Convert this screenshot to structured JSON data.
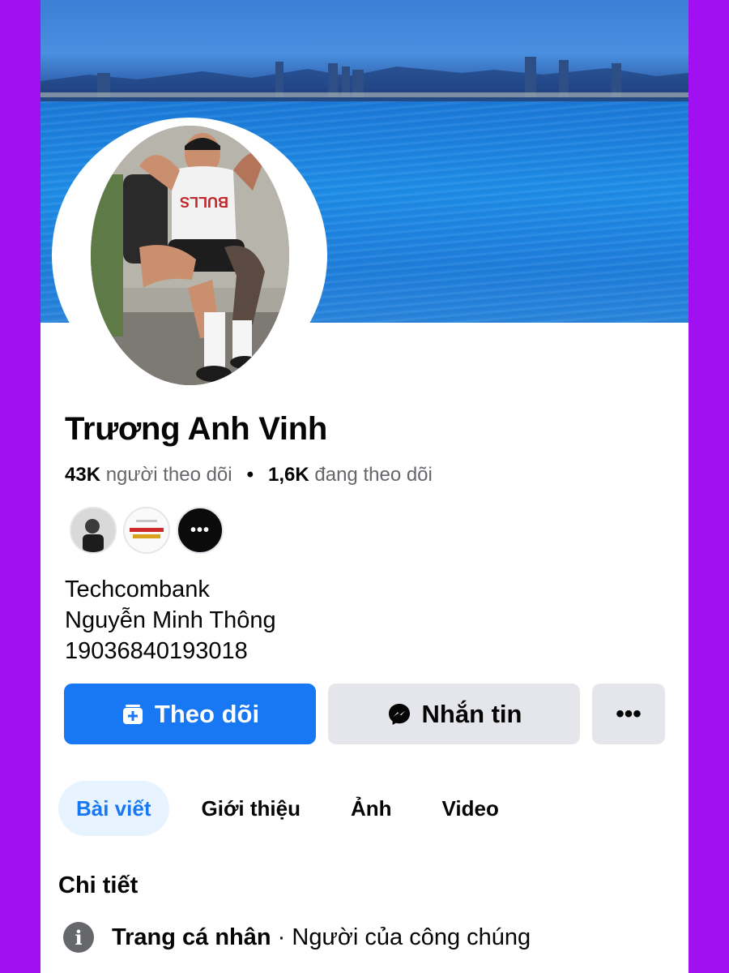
{
  "profile": {
    "name": "Trương Anh Vinh",
    "followers_count": "43K",
    "followers_label": "người theo dõi",
    "following_count": "1,6K",
    "following_label": "đang theo dõi",
    "separator": "•",
    "mutual_more_label": "•••",
    "bio": [
      "Techcombank",
      "Nguyễn Minh Thông",
      "19036840193018"
    ]
  },
  "actions": {
    "follow_label": "Theo dõi",
    "message_label": "Nhắn tin",
    "more_label": "•••"
  },
  "tabs": [
    {
      "label": "Bài viết",
      "active": true
    },
    {
      "label": "Giới thiệu",
      "active": false
    },
    {
      "label": "Ảnh",
      "active": false
    },
    {
      "label": "Video",
      "active": false
    }
  ],
  "details": {
    "title": "Chi tiết",
    "item_strong": "Trang cá nhân",
    "item_sep": "·",
    "item_rest": "Người của công chúng"
  },
  "colors": {
    "accent": "#1877f2",
    "background_frame": "#a010f0",
    "button_secondary": "#e4e6eb",
    "active_tab_bg": "#e7f3ff"
  },
  "icons": {
    "follow": "follow-plus-icon",
    "message": "messenger-icon",
    "info": "info-icon"
  }
}
